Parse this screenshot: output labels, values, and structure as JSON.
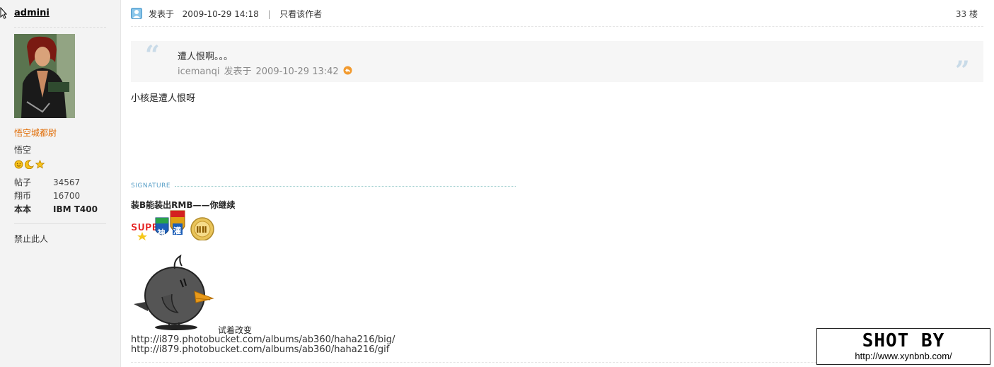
{
  "author": {
    "username": "admini",
    "rank": "悟空城都尉",
    "group": "悟空",
    "stats": [
      {
        "label": "帖子",
        "value": "34567"
      },
      {
        "label": "翔币",
        "value": "16700"
      },
      {
        "label": "本本",
        "value": "IBM T400"
      }
    ],
    "ban_label": "禁止此人"
  },
  "post": {
    "posted_label": "发表于",
    "datetime": "2009-10-29 14:18",
    "separator": "|",
    "only_author_label": "只看该作者",
    "floor": "33 楼",
    "quote": {
      "text": "遭人恨啊。。。",
      "author": "icemanqi",
      "posted_label": "发表于",
      "datetime": "2009-10-29 13:42"
    },
    "body": "小核是遭人恨呀"
  },
  "signature": {
    "label": "SIGNATURE",
    "title": "装B能装出RMB——你继续",
    "image_caption": "试着改变",
    "url1": "http://i879.photobucket.com/albums/ab360/haha216/big/",
    "url2": "http://i879.photobucket.com/albums/ab360/haha216/gif"
  },
  "watermark": {
    "title": "SHOT BY",
    "url": "http://www.xynbnb.com/"
  },
  "colors": {
    "rank": "#e06a00",
    "signature_label": "#5aa0c8",
    "sidebar_bg": "#f3f3f3",
    "quote_bg": "#f6f6f6"
  }
}
